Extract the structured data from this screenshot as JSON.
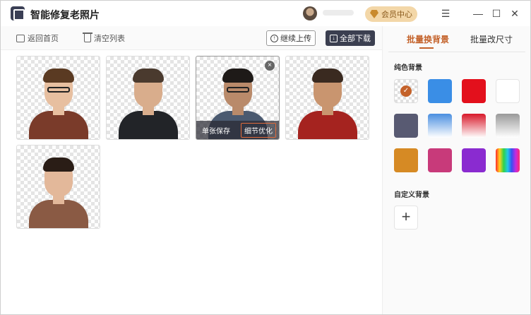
{
  "app": {
    "title": "智能修复老照片"
  },
  "header": {
    "vip_label": "会员中心"
  },
  "window_controls": {
    "menu": "☰",
    "minimize": "—",
    "maximize": "☐",
    "close": "✕"
  },
  "toolbar": {
    "back_label": "返回首页",
    "clear_label": "清空列表",
    "continue_upload_label": "继续上传",
    "download_all_label": "全部下载"
  },
  "photos": [
    {
      "hair": "#5a3a22",
      "skin": "#e7bfa0",
      "clothes": "#7a3b2a",
      "glasses": true
    },
    {
      "hair": "#4a3a2e",
      "skin": "#d9ad8c",
      "clothes": "#222428",
      "glasses": false
    },
    {
      "hair": "#1e1a18",
      "skin": "#b98a6a",
      "clothes": "#4b5a70",
      "glasses": true,
      "selected": true
    },
    {
      "hair": "#3a2a20",
      "skin": "#c9956f",
      "clothes": "#a5231f",
      "glasses": false
    },
    {
      "hair": "#2a1d16",
      "skin": "#e3b89a",
      "clothes": "#8a5a44",
      "glasses": false
    }
  ],
  "photo_overlay": {
    "save_label": "单张保存",
    "detail_label": "细节优化",
    "close_glyph": "×"
  },
  "right_panel": {
    "tab_batch_bg": "批量换背景",
    "tab_batch_size": "批量改尺寸",
    "solid_label": "纯色背景",
    "custom_label": "自定义背景",
    "add_glyph": "+",
    "check_glyph": "✓",
    "swatches": [
      {
        "kind": "transparent",
        "selected": true
      },
      {
        "kind": "solid",
        "color": "#3a8ee6"
      },
      {
        "kind": "solid",
        "color": "#e3101c"
      },
      {
        "kind": "solid",
        "color": "#ffffff"
      },
      {
        "kind": "solid",
        "color": "#585a72"
      },
      {
        "kind": "gradient",
        "from": "#4a8fe0",
        "to": "#ffffff"
      },
      {
        "kind": "gradient",
        "from": "#d8192a",
        "to": "#ffffff"
      },
      {
        "kind": "gradient",
        "from": "#9a9a9a",
        "to": "#ffffff"
      },
      {
        "kind": "solid",
        "color": "#d68a24"
      },
      {
        "kind": "solid",
        "color": "#c83a7a"
      },
      {
        "kind": "solid",
        "color": "#8a2bd0"
      },
      {
        "kind": "rainbow"
      }
    ]
  }
}
